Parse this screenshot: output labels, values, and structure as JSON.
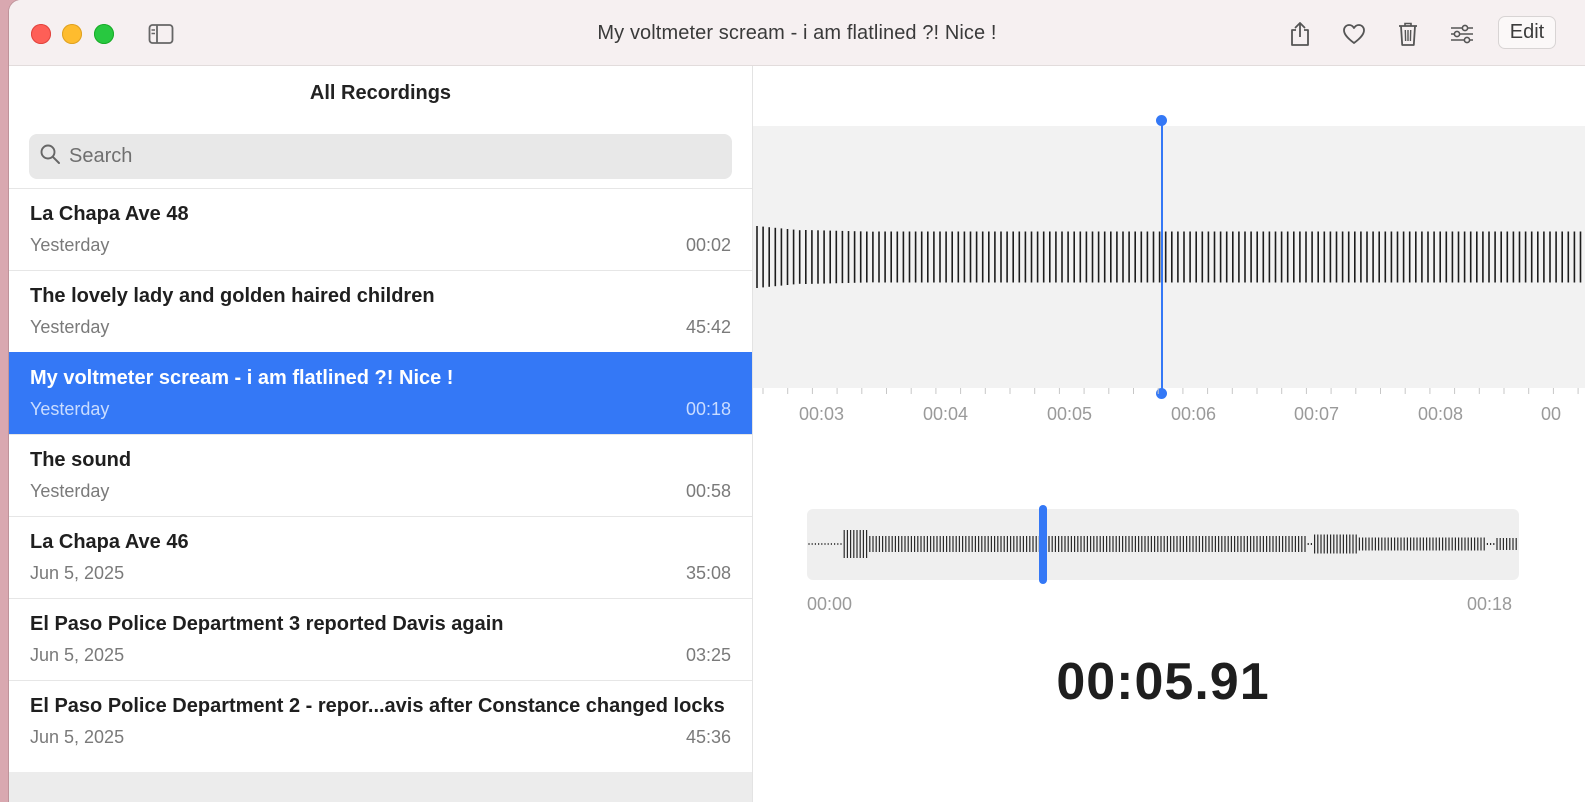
{
  "window": {
    "title": "My voltmeter scream - i am flatlined ?! Nice !",
    "edit_label": "Edit",
    "toolbar_icons": [
      "sidebar-toggle-icon",
      "share-icon",
      "heart-icon",
      "trash-icon",
      "sliders-icon"
    ]
  },
  "list": {
    "header": "All Recordings",
    "search_placeholder": "Search",
    "selected_index": 2,
    "items": [
      {
        "title": "La Chapa Ave 48",
        "date": "Yesterday",
        "duration": "00:02"
      },
      {
        "title": "The lovely lady and golden haired children",
        "date": "Yesterday",
        "duration": "45:42"
      },
      {
        "title": "My voltmeter scream - i am flatlined ?! Nice !",
        "date": "Yesterday",
        "duration": "00:18"
      },
      {
        "title": "The sound",
        "date": "Yesterday",
        "duration": "00:58"
      },
      {
        "title": "La Chapa Ave 46",
        "date": "Jun 5, 2025",
        "duration": "35:08"
      },
      {
        "title": "El Paso Police Department 3 reported Davis again",
        "date": "Jun 5, 2025",
        "duration": "03:25"
      },
      {
        "title": "El Paso Police Department 2 - repor...avis after Constance changed locks",
        "date": "Jun 5, 2025",
        "duration": "45:36"
      }
    ]
  },
  "player": {
    "ruler_labels": [
      "00:03",
      "00:04",
      "00:05",
      "00:06",
      "00:07",
      "00:08",
      "00"
    ],
    "overview_start": "00:00",
    "overview_end": "00:18",
    "current_time": "00:05.91",
    "accent_color": "#3478f6"
  }
}
